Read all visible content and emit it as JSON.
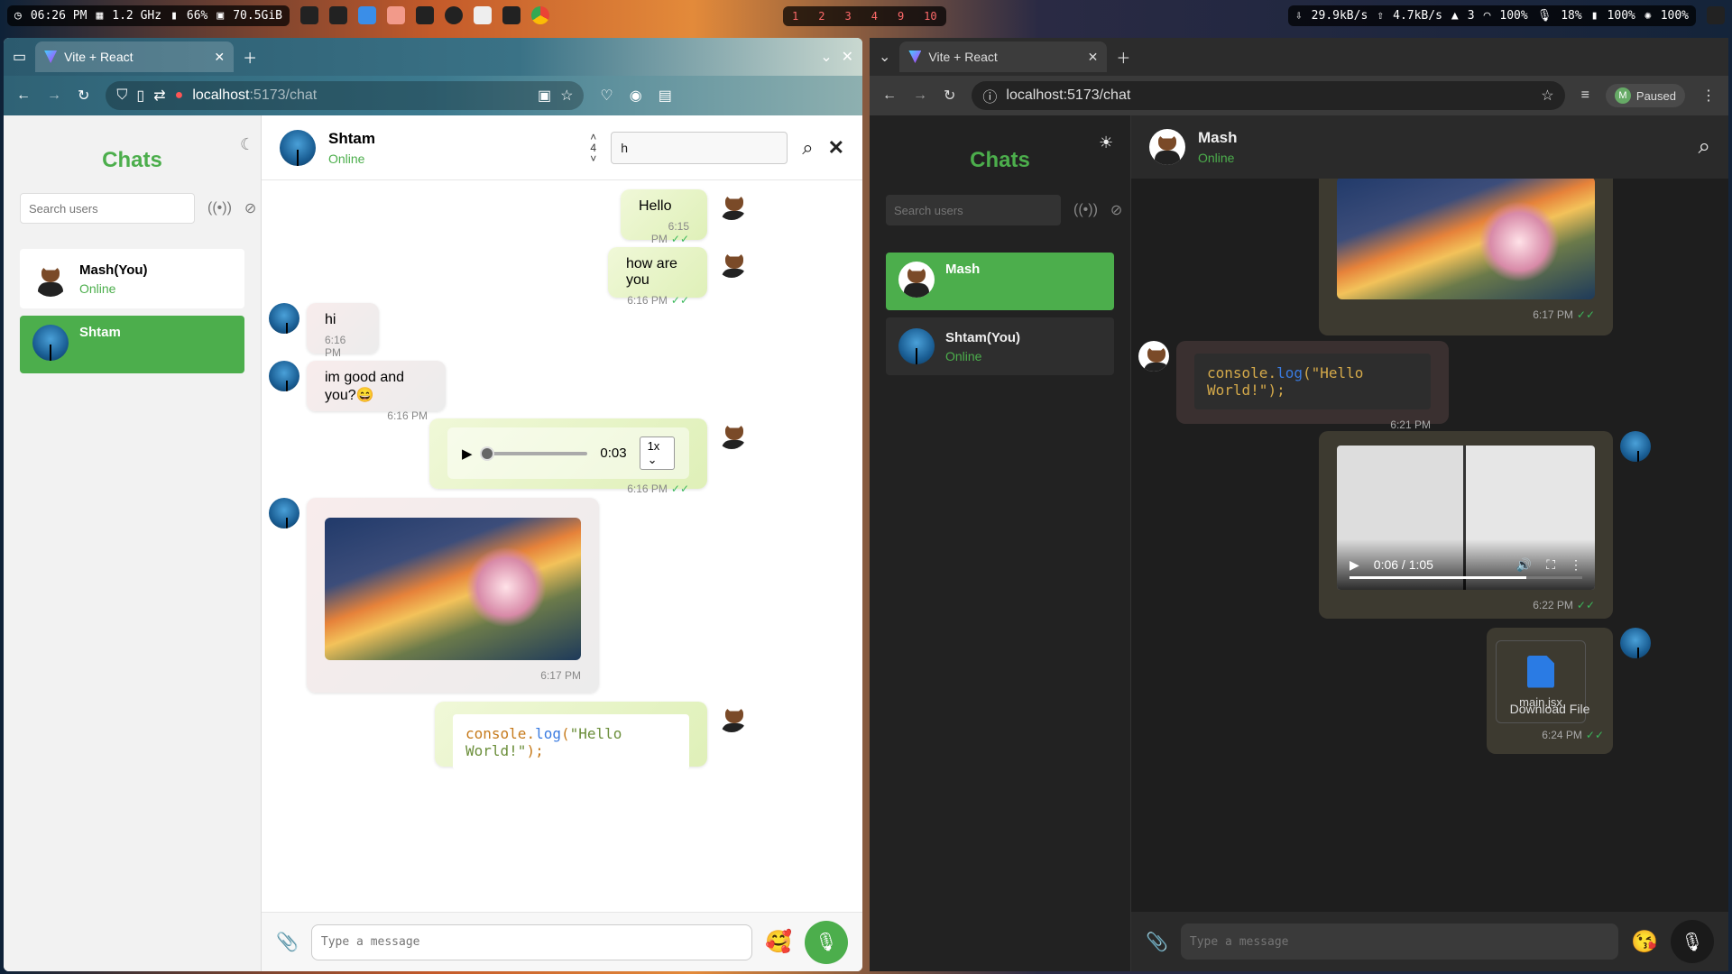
{
  "topbar": {
    "time": "06:26 PM",
    "cpu": "1.2 GHz",
    "battery": "66%",
    "disk": "70.5GiB",
    "workspaces": [
      "1",
      "2",
      "3",
      "4",
      "9",
      "10"
    ],
    "net_down": "29.9kB/s",
    "net_up": "4.7kB/s",
    "updates": "3",
    "wifi": "100%",
    "mic": "18%",
    "battery2": "100%",
    "brightness": "100%"
  },
  "left_window": {
    "tab_title": "Vite + React",
    "url_host": "localhost",
    "url_path": ":5173/chat",
    "sidebar": {
      "title": "Chats",
      "search_placeholder": "Search users",
      "users": [
        {
          "name": "Mash(You)",
          "status": "Online"
        },
        {
          "name": "Shtam",
          "status": ""
        }
      ]
    },
    "header": {
      "name": "Shtam",
      "status": "Online",
      "search_count": "4",
      "search_value": "h"
    },
    "messages": [
      {
        "text": "Hello",
        "time": "6:15 PM"
      },
      {
        "text": "how are you",
        "time": "6:16 PM"
      },
      {
        "text": "hi",
        "time": "6:16 PM"
      },
      {
        "text": "im good and you?😄",
        "time": "6:16 PM"
      },
      {
        "audio_time": "0:03",
        "speed": "1x",
        "time": "6:16 PM"
      },
      {
        "time": "6:17 PM"
      },
      {
        "code_obj": "console",
        "code_dot": ".",
        "code_fn": "log",
        "code_open": "(",
        "code_str": "\"Hello World!\"",
        "code_close": ");"
      }
    ],
    "composer_placeholder": "Type a message"
  },
  "right_window": {
    "tab_title": "Vite + React",
    "url": "localhost:5173/chat",
    "profile_label": "Paused",
    "profile_initial": "M",
    "sidebar": {
      "title": "Chats",
      "search_placeholder": "Search users",
      "users": [
        {
          "name": "Mash",
          "status": ""
        },
        {
          "name": "Shtam(You)",
          "status": "Online"
        }
      ]
    },
    "header": {
      "name": "Mash",
      "status": "Online"
    },
    "messages": [
      {
        "time": "6:17 PM"
      },
      {
        "code_obj": "console",
        "code_dot": ".",
        "code_fn": "log",
        "code_open": "(",
        "code_str": "\"Hello World!\"",
        "code_close": ");",
        "time": "6:21 PM"
      },
      {
        "video_time": "0:06 / 1:05",
        "time": "6:22 PM"
      },
      {
        "file_name": "main.jsx",
        "download": "Download File",
        "time": "6:24 PM"
      }
    ],
    "composer_placeholder": "Type a message"
  },
  "colors": {
    "accent": "#4cae4c",
    "tick": "#3bb85b",
    "file_icon": "#2a7be4"
  }
}
